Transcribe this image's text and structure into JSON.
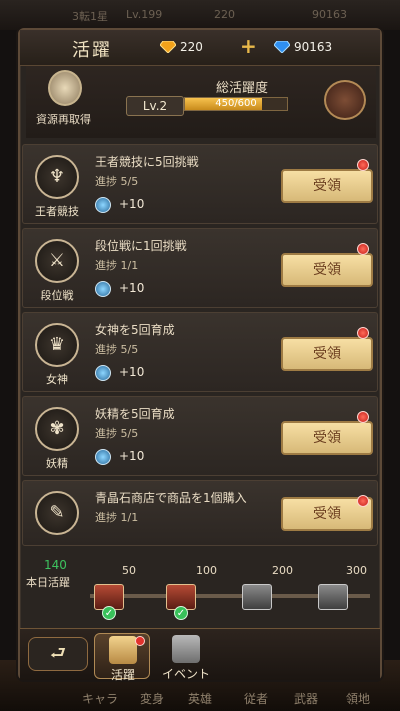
{
  "background": {
    "top": {
      "rank": "3転1星",
      "level": "Lv.199",
      "gold": "220",
      "gems": "90163"
    },
    "bottom_nav": [
      "キャラ",
      "変身",
      "英雄",
      "従者",
      "武器",
      "領地"
    ]
  },
  "header": {
    "title": "活躍",
    "gold": "220",
    "gems": "90163",
    "add_label": "+"
  },
  "daily": {
    "resource_label": "資源再取得",
    "level": "Lv.2",
    "total_label": "総活躍度",
    "progress_text": "450/600",
    "progress_fraction": 0.75
  },
  "tasks": [
    {
      "icon_label": "王者競技",
      "task": "王者競技に5回挑戦",
      "progress": "進捗 5/5",
      "reward": "+10",
      "button": "受領"
    },
    {
      "icon_label": "段位戦",
      "task": "段位戦に1回挑戦",
      "progress": "進捗 1/1",
      "reward": "+10",
      "button": "受領"
    },
    {
      "icon_label": "女神",
      "task": "女神を5回育成",
      "progress": "進捗 5/5",
      "reward": "+10",
      "button": "受領"
    },
    {
      "icon_label": "妖精",
      "task": "妖精を5回育成",
      "progress": "進捗 5/5",
      "reward": "+10",
      "button": "受領"
    },
    {
      "icon_label": "",
      "task": "青晶石商店で商品を1個購入",
      "progress": "進捗 1/1",
      "reward": "",
      "button": "受領"
    }
  ],
  "daily_track": {
    "label": "本日活躍",
    "value": "140",
    "milestones": [
      {
        "value": "50",
        "claimed": true
      },
      {
        "value": "100",
        "claimed": true
      },
      {
        "value": "200",
        "claimed": false
      },
      {
        "value": "300",
        "claimed": false
      }
    ]
  },
  "bottom_tabs": [
    {
      "label": "活躍",
      "active": true
    },
    {
      "label": "イベント",
      "active": false
    }
  ],
  "colors": {
    "accent_gold": "#f0c44d",
    "claim_button": "#e6cf95",
    "badge_red": "#e2322c",
    "progress_green": "#3dc25f"
  }
}
